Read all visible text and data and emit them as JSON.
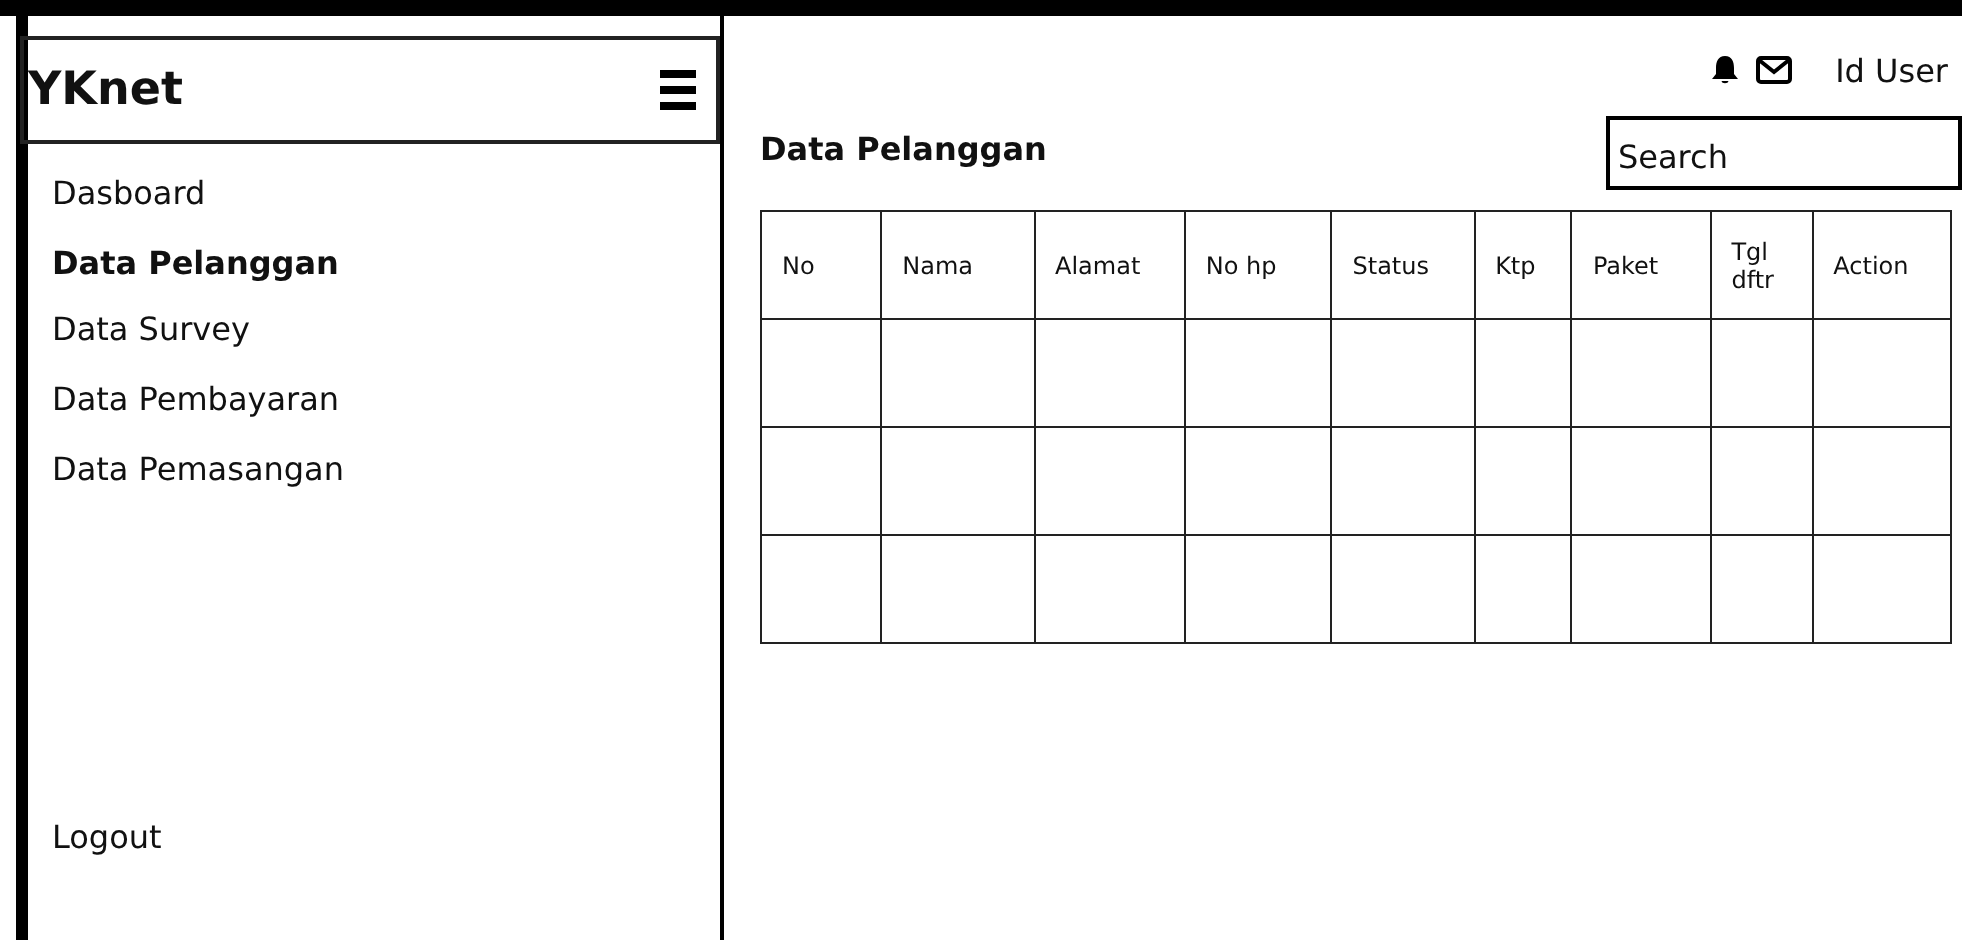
{
  "sidebar": {
    "brand": "YKnet",
    "items": [
      {
        "label": "Dasboard",
        "selected": false
      },
      {
        "label": "Data Pelanggan",
        "selected": true
      },
      {
        "label": "Data Survey",
        "selected": false
      },
      {
        "label": "Data Pembayaran",
        "selected": false
      },
      {
        "label": "Data Pemasangan",
        "selected": false
      }
    ],
    "logout": "Logout"
  },
  "topbar": {
    "user": "Id User"
  },
  "page": {
    "title": "Data Pelanggan",
    "search": {
      "placeholder": "Search"
    }
  },
  "table": {
    "columns": [
      "No",
      "Nama",
      "Alamat",
      "No hp",
      "Status",
      "Ktp",
      "Paket",
      "Tgl dftr",
      "Action"
    ]
  }
}
